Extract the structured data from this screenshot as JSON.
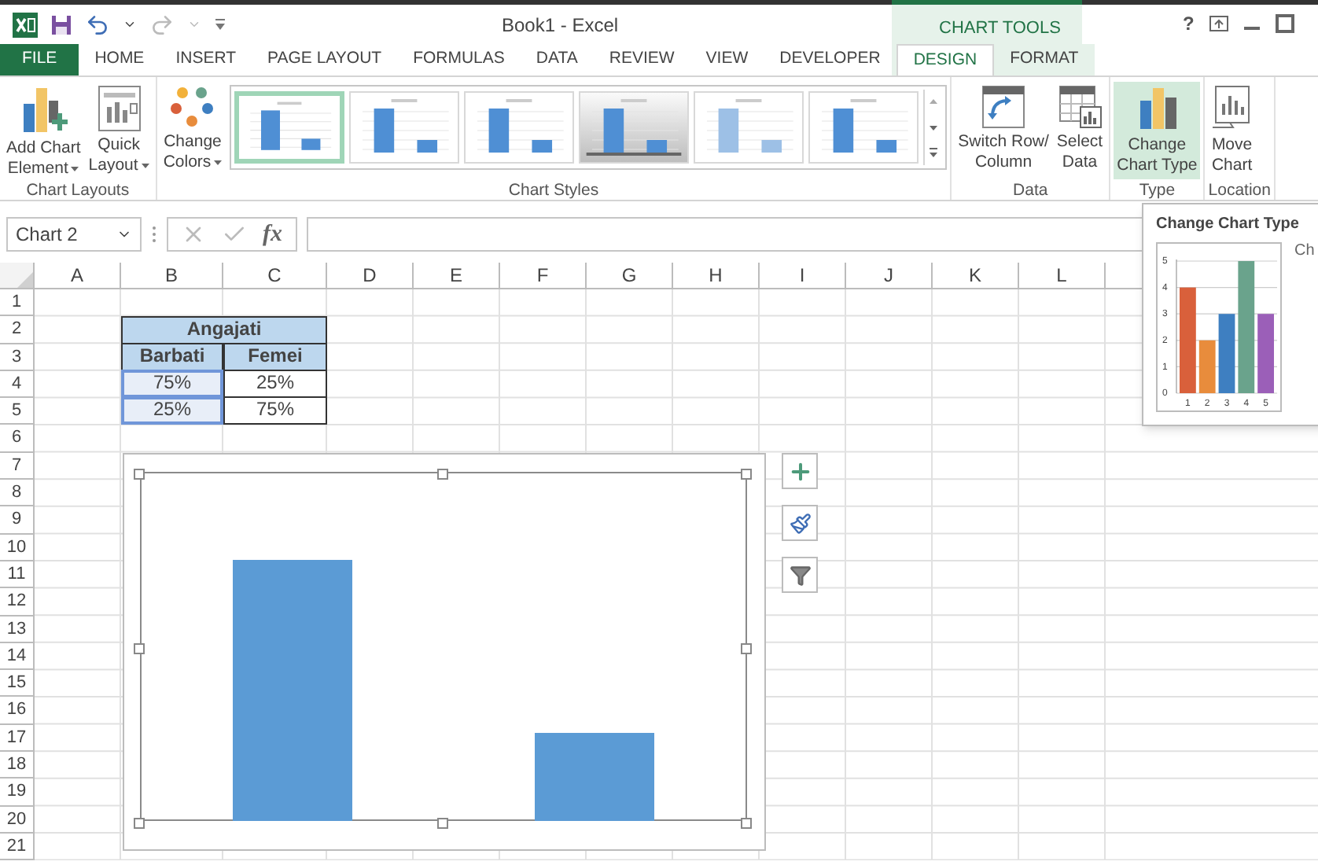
{
  "window": {
    "title": "Book1 - Excel",
    "context_group": "CHART TOOLS",
    "help": "?"
  },
  "tabs": [
    {
      "label": "FILE",
      "kind": "file",
      "selected": false
    },
    {
      "label": "HOME",
      "kind": "normal",
      "selected": false
    },
    {
      "label": "INSERT",
      "kind": "normal",
      "selected": false
    },
    {
      "label": "PAGE LAYOUT",
      "kind": "normal",
      "selected": false
    },
    {
      "label": "FORMULAS",
      "kind": "normal",
      "selected": false
    },
    {
      "label": "DATA",
      "kind": "normal",
      "selected": false
    },
    {
      "label": "REVIEW",
      "kind": "normal",
      "selected": false
    },
    {
      "label": "VIEW",
      "kind": "normal",
      "selected": false
    },
    {
      "label": "DEVELOPER",
      "kind": "normal",
      "selected": false
    },
    {
      "label": "DESIGN",
      "kind": "context",
      "selected": true
    },
    {
      "label": "FORMAT",
      "kind": "context",
      "selected": false
    }
  ],
  "ribbon": {
    "groups": [
      {
        "label": "Chart Layouts",
        "buttons": [
          {
            "lines": [
              "Add Chart",
              "Element"
            ],
            "dropdown": true,
            "selected": false
          },
          {
            "lines": [
              "Quick",
              "Layout"
            ],
            "dropdown": true,
            "selected": false
          }
        ]
      },
      {
        "label": "Chart Styles",
        "buttons": [
          {
            "lines": [
              "Change",
              "Colors"
            ],
            "dropdown": true,
            "selected": false
          }
        ],
        "gallery": [
          {
            "selected": true
          },
          {
            "selected": false
          },
          {
            "selected": false
          },
          {
            "selected": false
          },
          {
            "selected": false
          },
          {
            "selected": false
          }
        ]
      },
      {
        "label": "Data",
        "buttons": [
          {
            "lines": [
              "Switch Row/",
              "Column"
            ],
            "dropdown": false,
            "selected": false
          },
          {
            "lines": [
              "Select",
              "Data"
            ],
            "dropdown": false,
            "selected": false
          }
        ]
      },
      {
        "label": "Type",
        "buttons": [
          {
            "lines": [
              "Change",
              "Chart Type"
            ],
            "dropdown": false,
            "selected": true
          }
        ]
      },
      {
        "label": "Location",
        "buttons": [
          {
            "lines": [
              "Move",
              "Chart"
            ],
            "dropdown": false,
            "selected": false
          }
        ]
      }
    ]
  },
  "name_box": "Chart 2",
  "formula_bar": {
    "function_label": "fx"
  },
  "sheet": {
    "columns": [
      "A",
      "B",
      "C",
      "D",
      "E",
      "F",
      "G",
      "H",
      "I",
      "J",
      "K",
      "L"
    ],
    "rows": [
      "1",
      "2",
      "3",
      "4",
      "5",
      "6",
      "7",
      "8",
      "9",
      "10",
      "11",
      "12",
      "13",
      "14",
      "15",
      "16",
      "17",
      "18",
      "19",
      "20",
      "21"
    ],
    "table": {
      "title": "Angajati",
      "headers": [
        "Barbati",
        "Femei"
      ],
      "rows": [
        [
          {
            "text": "75%",
            "selected": true
          },
          {
            "text": "25%",
            "selected": false
          }
        ],
        [
          {
            "text": "25%",
            "selected": true
          },
          {
            "text": "75%",
            "selected": false
          }
        ]
      ]
    }
  },
  "tooltip": {
    "title": "Change Chart Type",
    "trailing_text": "Ch",
    "chart_data": {
      "type": "bar",
      "categories": [
        "1",
        "2",
        "3",
        "4",
        "5"
      ],
      "values": [
        4,
        2,
        3,
        5,
        3
      ],
      "ylim": [
        0,
        5
      ],
      "grid": true,
      "yticks": [
        0,
        1,
        2,
        3,
        4,
        5
      ]
    }
  }
}
